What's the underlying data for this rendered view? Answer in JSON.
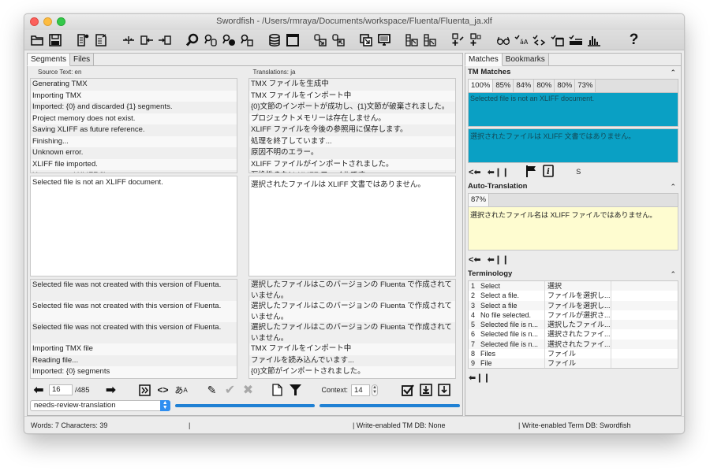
{
  "window": {
    "title": "Swordfish - /Users/rmraya/Documents/workspace/Fluenta/Fluenta_ja.xlf"
  },
  "toolbar": {
    "groups": [
      [
        "open-icon",
        "save-icon"
      ],
      [
        "new-file-icon",
        "export-file-icon"
      ],
      [
        "split-segment-icon",
        "merge-prev-icon",
        "merge-next-icon"
      ],
      [
        "search-icon",
        "search-tm-icon",
        "search-web-icon",
        "search-term-icon"
      ],
      [
        "database-icon",
        "window-icon"
      ],
      [
        "tm-import-icon",
        "tm-export-icon"
      ],
      [
        "copy-source-icon",
        "preview-icon"
      ],
      [
        "glossary-import-icon",
        "glossary-export-icon"
      ],
      [
        "add-term-icon",
        "add-term-alt-icon"
      ],
      [
        "review-glasses-icon",
        "check-spelling-icon",
        "check-tags-icon",
        "check-segments-icon",
        "check-length-icon",
        "statistics-icon"
      ],
      [
        "help-icon"
      ]
    ]
  },
  "left": {
    "tabs": [
      {
        "label": "Segments",
        "active": true
      },
      {
        "label": "Files",
        "active": false
      }
    ],
    "source_header": "Source Text: en",
    "target_header": "Translations: ja",
    "top_rows": [
      {
        "source": "Generating TMX",
        "target": "TMX ファイルを生成中"
      },
      {
        "source": "Importing TMX",
        "target": "TMX ファイルをインポート中"
      },
      {
        "source": "Imported: {0} and discarded {1} segments.",
        "target": "{0}文節のインポートが成功し、{1}文節が破棄されました。"
      },
      {
        "source": "Project memory does not exist.",
        "target": "プロジェクトメモリーは存在しません。"
      },
      {
        "source": "Saving XLIFF as future reference.",
        "target": "XLIFF ファイルを今後の参照用に保存します。"
      },
      {
        "source": "Finishing...",
        "target": "処理を終了しています..."
      },
      {
        "source": "Unknown error.",
        "target": "原因不明のエラー。"
      },
      {
        "source": "XLIFF file imported.",
        "target": "XLIFF ファイルがインポートされました。"
      },
      {
        "source": "Unsupported XLIFF file.",
        "target": "互換性のない XLIFF ファイルです。"
      }
    ],
    "current_source": "Selected file is not an XLIFF document.",
    "current_target": "選択されたファイルは XLIFF 文書ではありません。",
    "bottom_rows": [
      {
        "source": "Selected file was not created with this version of Fluenta.",
        "target": "選択したファイルはこのバージョンの Fluenta で作成されていません。",
        "tall": true
      },
      {
        "source": "Selected file was not created with this version of Fluenta.",
        "target": "選択したファイルはこのバージョンの Fluenta で作成されていません。",
        "tall": true
      },
      {
        "source": "Selected file was not created with this version of Fluenta.",
        "target": "選択したファイルはこのバージョンの Fluenta で作成されていません。",
        "tall": true
      },
      {
        "source": "Importing TMX file",
        "target": "TMX ファイルをインポート中"
      },
      {
        "source": "Reading file...",
        "target": "ファイルを読み込んでいます..."
      },
      {
        "source": "Imported: {0} segments",
        "target": "{0}文節がインポートされました。"
      }
    ],
    "navigation": {
      "current_segment": "16",
      "total_segments": "/485",
      "context_label": "Context:",
      "context_value": "14"
    },
    "state": {
      "selected": "needs-review-translation"
    },
    "progress": [
      {
        "name": "translated-progress",
        "percent": 100
      },
      {
        "name": "approved-progress",
        "percent": 100
      }
    ]
  },
  "right": {
    "tabs": [
      {
        "label": "Matches",
        "active": true
      },
      {
        "label": "Bookmarks",
        "active": false
      }
    ],
    "tm_matches": {
      "title": "TM Matches",
      "match_tabs": [
        "100%",
        "85%",
        "84%",
        "80%",
        "80%",
        "73%"
      ],
      "source": "Selected file is not an XLIFF document.",
      "target": "選択されたファイルは XLIFF 文書ではありません。",
      "match_color": "#0aa0c4"
    },
    "auto_translation": {
      "title": "Auto-Translation",
      "match_tabs": [
        "87%"
      ],
      "target": "選択されたファイル名は XLIFF ファイルではありません。",
      "box_color": "#fefcd0"
    },
    "terminology": {
      "title": "Terminology",
      "rows": [
        {
          "n": "1",
          "source": "Select",
          "target": "選択"
        },
        {
          "n": "2",
          "source": "Select a file.",
          "target": "ファイルを選択し..."
        },
        {
          "n": "3",
          "source": "Select a file",
          "target": "ファイルを選択し..."
        },
        {
          "n": "4",
          "source": "No file selected.",
          "target": "ファイルが選択さ..."
        },
        {
          "n": "5",
          "source": "Selected file is n...",
          "target": "選択したファイル..."
        },
        {
          "n": "6",
          "source": "Selected file is n...",
          "target": "選択されたファイ..."
        },
        {
          "n": "7",
          "source": "Selected file is n...",
          "target": "選択されたファイ..."
        },
        {
          "n": "8",
          "source": "Files",
          "target": "ファイル"
        },
        {
          "n": "9",
          "source": "File",
          "target": "ファイル"
        }
      ]
    },
    "collapse_glyph": "⌃"
  },
  "statusbar": {
    "counts": "Words: 7 Characters: 39",
    "sep1": "|",
    "tm_db": "|  Write-enabled TM DB: None",
    "term_db": "|  Write-enabled Term DB: Swordfish"
  }
}
